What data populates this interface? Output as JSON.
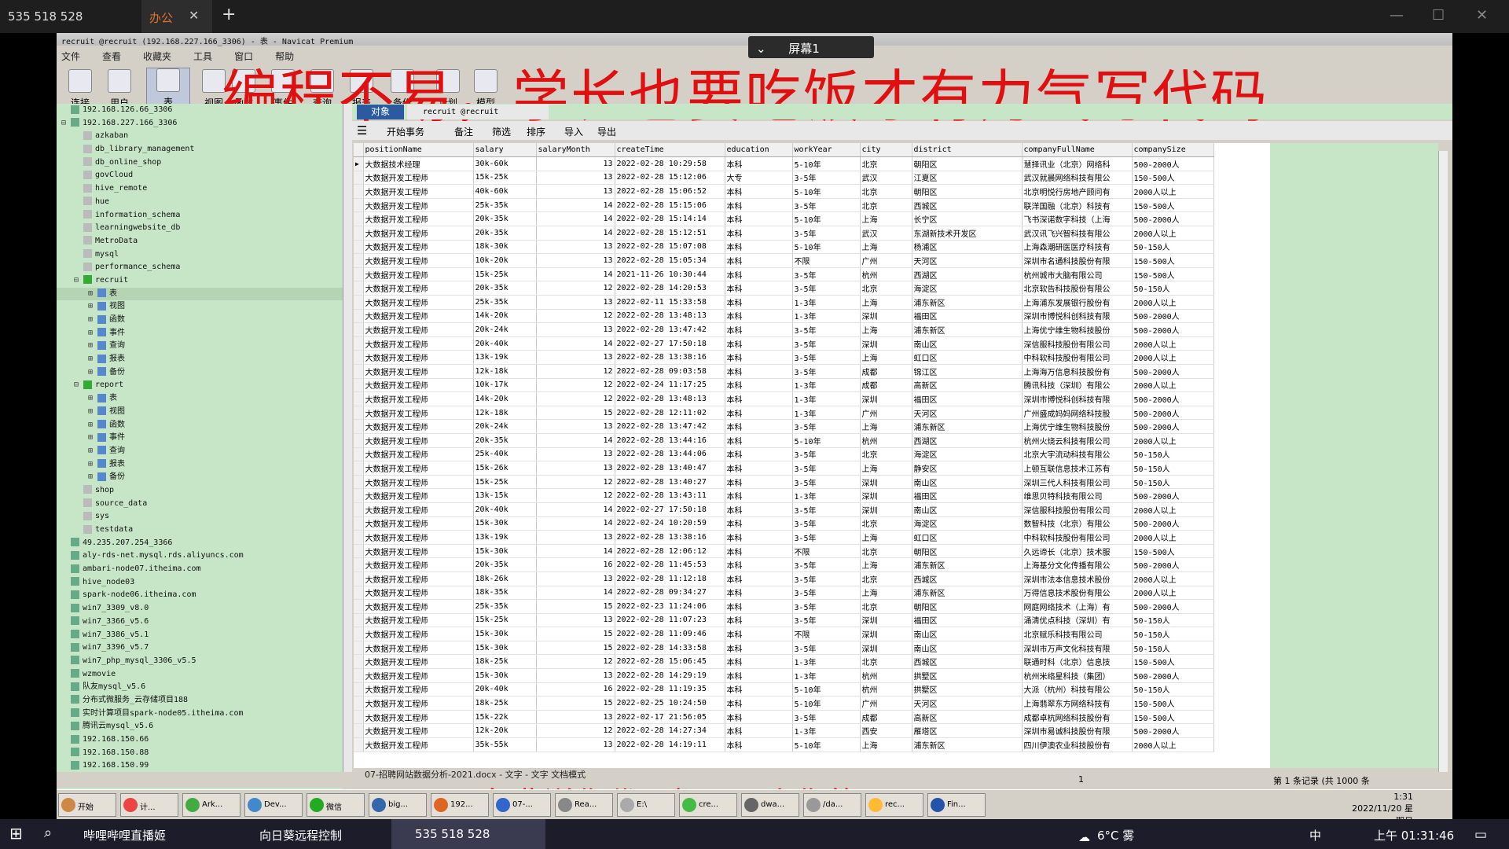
{
  "remote": {
    "signal_label": "535 518 528",
    "tab_label": "办公",
    "close": "✕",
    "new": "+",
    "min": "—",
    "max": "☐",
    "close_win": "✕"
  },
  "window": {
    "title": "recruit @recruit (192.168.227.166_3306) - 表 - Navicat Premium",
    "screen_label": "屏幕1"
  },
  "menu": [
    "文件",
    "查看",
    "收藏夹",
    "工具",
    "窗口",
    "帮助"
  ],
  "toolbar": [
    "连接",
    "用户",
    "表",
    "视图",
    "函数",
    "事件",
    "查询",
    "报表",
    "备份",
    "计划",
    "模型"
  ],
  "overlay": {
    "banner": "编程不易，学长也要吃饭才有力气写代码",
    "bottom": "免费送你代码都是马扁你的"
  },
  "tree": [
    {
      "t": "192.168.126.66_3306",
      "l": 1,
      "k": "conn"
    },
    {
      "t": "192.168.227.166_3306",
      "l": 1,
      "k": "conn",
      "open": true
    },
    {
      "t": "azkaban",
      "l": 2,
      "k": "db"
    },
    {
      "t": "db_library_management",
      "l": 2,
      "k": "db"
    },
    {
      "t": "db_online_shop",
      "l": 2,
      "k": "db"
    },
    {
      "t": "govCloud",
      "l": 2,
      "k": "db"
    },
    {
      "t": "hive_remote",
      "l": 2,
      "k": "db"
    },
    {
      "t": "hue",
      "l": 2,
      "k": "db"
    },
    {
      "t": "information_schema",
      "l": 2,
      "k": "db"
    },
    {
      "t": "learningwebsite_db",
      "l": 2,
      "k": "db"
    },
    {
      "t": "MetroData",
      "l": 2,
      "k": "db"
    },
    {
      "t": "mysql",
      "l": 2,
      "k": "db"
    },
    {
      "t": "performance_schema",
      "l": 2,
      "k": "db"
    },
    {
      "t": "recruit",
      "l": 2,
      "k": "dbopen",
      "open": true
    },
    {
      "t": "表",
      "l": 3,
      "k": "obj",
      "sel": true
    },
    {
      "t": "视图",
      "l": 3,
      "k": "obj"
    },
    {
      "t": "函数",
      "l": 3,
      "k": "obj"
    },
    {
      "t": "事件",
      "l": 3,
      "k": "obj"
    },
    {
      "t": "查询",
      "l": 3,
      "k": "obj"
    },
    {
      "t": "报表",
      "l": 3,
      "k": "obj"
    },
    {
      "t": "备份",
      "l": 3,
      "k": "obj"
    },
    {
      "t": "report",
      "l": 2,
      "k": "dbopen",
      "open": true
    },
    {
      "t": "表",
      "l": 3,
      "k": "obj"
    },
    {
      "t": "视图",
      "l": 3,
      "k": "obj"
    },
    {
      "t": "函数",
      "l": 3,
      "k": "obj"
    },
    {
      "t": "事件",
      "l": 3,
      "k": "obj"
    },
    {
      "t": "查询",
      "l": 3,
      "k": "obj"
    },
    {
      "t": "报表",
      "l": 3,
      "k": "obj"
    },
    {
      "t": "备份",
      "l": 3,
      "k": "obj"
    },
    {
      "t": "shop",
      "l": 2,
      "k": "db"
    },
    {
      "t": "source_data",
      "l": 2,
      "k": "db"
    },
    {
      "t": "sys",
      "l": 2,
      "k": "db"
    },
    {
      "t": "testdata",
      "l": 2,
      "k": "db"
    },
    {
      "t": "49.235.207.254_3366",
      "l": 1,
      "k": "conn"
    },
    {
      "t": "aly-rds-net.mysql.rds.aliyuncs.com",
      "l": 1,
      "k": "conn"
    },
    {
      "t": "ambari-node07.itheima.com",
      "l": 1,
      "k": "conn"
    },
    {
      "t": "hive_node03",
      "l": 1,
      "k": "conn"
    },
    {
      "t": "spark-node06.itheima.com",
      "l": 1,
      "k": "conn"
    },
    {
      "t": "win7_3309_v8.0",
      "l": 1,
      "k": "conn"
    },
    {
      "t": "win7_3366_v5.6",
      "l": 1,
      "k": "conn"
    },
    {
      "t": "win7_3386_v5.1",
      "l": 1,
      "k": "conn"
    },
    {
      "t": "win7_3396_v5.7",
      "l": 1,
      "k": "conn"
    },
    {
      "t": "win7_php_mysql_3306_v5.5",
      "l": 1,
      "k": "conn"
    },
    {
      "t": "wzmovie",
      "l": 1,
      "k": "conn"
    },
    {
      "t": "队友mysql_v5.6",
      "l": 1,
      "k": "conn"
    },
    {
      "t": "分布式微服务_云存储项目188",
      "l": 1,
      "k": "conn"
    },
    {
      "t": "实时计算项目spark-node05.itheima.com",
      "l": 1,
      "k": "conn"
    },
    {
      "t": "腾讯云mysql_v5.6",
      "l": 1,
      "k": "conn"
    },
    {
      "t": "192.168.150.66",
      "l": 1,
      "k": "conn"
    },
    {
      "t": "192.168.150.88",
      "l": 1,
      "k": "conn"
    },
    {
      "t": "192.168.150.99",
      "l": 1,
      "k": "conn"
    }
  ],
  "tabs": {
    "objects": "对象",
    "table_tab": "recruit @recruit (192.168..."
  },
  "obj_toolbar": [
    "开始事务",
    "备注",
    "筛选",
    "排序",
    "导入",
    "导出"
  ],
  "table": {
    "columns": [
      "positionName",
      "salary",
      "salaryMonth",
      "createTime",
      "education",
      "workYear",
      "city",
      "district",
      "companyFullName",
      "companySize"
    ],
    "rows": [
      [
        "大数据技术经理",
        "30k-60k",
        "13",
        "2022-02-28 10:29:58",
        "本科",
        "5-10年",
        "北京",
        "朝阳区",
        "慧择讯业（北京）网络科",
        "500-2000人"
      ],
      [
        "大数据开发工程师",
        "15k-25k",
        "13",
        "2022-02-28 15:12:06",
        "大专",
        "3-5年",
        "武汉",
        "江夏区",
        "武汉就晨网络科技有限公",
        "150-500人"
      ],
      [
        "大数据开发工程师",
        "40k-60k",
        "13",
        "2022-02-28 15:06:52",
        "本科",
        "5-10年",
        "北京",
        "朝阳区",
        "北京明悦行房地产顾问有",
        "2000人以上"
      ],
      [
        "大数据开发工程师",
        "25k-35k",
        "14",
        "2022-02-28 15:15:06",
        "本科",
        "3-5年",
        "北京",
        "西城区",
        "联洋国融（北京）科技有",
        "150-500人"
      ],
      [
        "大数据开发工程师",
        "20k-35k",
        "14",
        "2022-02-28 15:14:14",
        "本科",
        "5-10年",
        "上海",
        "长宁区",
        "飞书深诺数字科技（上海",
        "500-2000人"
      ],
      [
        "大数据开发工程师",
        "20k-35k",
        "14",
        "2022-02-28 15:12:51",
        "本科",
        "3-5年",
        "武汉",
        "东湖新技术开发区",
        "武汉讯飞兴智科技有限公",
        "2000人以上"
      ],
      [
        "大数据开发工程师",
        "18k-30k",
        "13",
        "2022-02-28 15:07:08",
        "本科",
        "5-10年",
        "上海",
        "杨浦区",
        "上海森潮研医医疗科技有",
        "50-150人"
      ],
      [
        "大数据开发工程师",
        "10k-20k",
        "13",
        "2022-02-28 15:05:34",
        "本科",
        "不限",
        "广州",
        "天河区",
        "深圳市名通科技股份有限",
        "150-500人"
      ],
      [
        "大数据开发工程师",
        "15k-25k",
        "14",
        "2021-11-26 10:30:44",
        "本科",
        "3-5年",
        "杭州",
        "西湖区",
        "杭州城市大脑有限公司",
        "150-500人"
      ],
      [
        "大数据开发工程师",
        "20k-35k",
        "12",
        "2022-02-28 14:20:53",
        "本科",
        "3-5年",
        "北京",
        "海淀区",
        "北京软告科技股份有限公",
        "50-150人"
      ],
      [
        "大数据开发工程师",
        "25k-35k",
        "13",
        "2022-02-11 15:33:58",
        "本科",
        "1-3年",
        "上海",
        "浦东新区",
        "上海浦东发展银行股份有",
        "2000人以上"
      ],
      [
        "大数据开发工程师",
        "14k-20k",
        "12",
        "2022-02-28 13:48:13",
        "本科",
        "1-3年",
        "深圳",
        "福田区",
        "深圳市博悦科创科技有限",
        "500-2000人"
      ],
      [
        "大数据开发工程师",
        "20k-24k",
        "13",
        "2022-02-28 13:47:42",
        "本科",
        "3-5年",
        "上海",
        "浦东新区",
        "上海优宁维生物科技股份",
        "500-2000人"
      ],
      [
        "大数据开发工程师",
        "20k-40k",
        "14",
        "2022-02-27 17:50:18",
        "本科",
        "3-5年",
        "深圳",
        "南山区",
        "深信服科技股份有限公司",
        "2000人以上"
      ],
      [
        "大数据开发工程师",
        "13k-19k",
        "13",
        "2022-02-28 13:38:16",
        "本科",
        "3-5年",
        "上海",
        "虹口区",
        "中科软科技股份有限公司",
        "2000人以上"
      ],
      [
        "大数据开发工程师",
        "12k-18k",
        "12",
        "2022-02-28 09:03:58",
        "本科",
        "3-5年",
        "成都",
        "锦江区",
        "上海海万信息科技股份有",
        "500-2000人"
      ],
      [
        "大数据开发工程师",
        "10k-17k",
        "12",
        "2022-02-24 11:17:25",
        "本科",
        "1-3年",
        "成都",
        "高新区",
        "腾讯科技（深圳）有限公",
        "2000人以上"
      ],
      [
        "大数据开发工程师",
        "14k-20k",
        "12",
        "2022-02-28 13:48:13",
        "本科",
        "1-3年",
        "深圳",
        "福田区",
        "深圳市博悦科创科技有限",
        "500-2000人"
      ],
      [
        "大数据开发工程师",
        "12k-18k",
        "15",
        "2022-02-28 12:11:02",
        "本科",
        "1-3年",
        "广州",
        "天河区",
        "广州盛成妈妈网络科技股",
        "500-2000人"
      ],
      [
        "大数据开发工程师",
        "20k-24k",
        "13",
        "2022-02-28 13:47:42",
        "本科",
        "3-5年",
        "上海",
        "浦东新区",
        "上海优宁维生物科技股份",
        "500-2000人"
      ],
      [
        "大数据开发工程师",
        "20k-35k",
        "14",
        "2022-02-28 13:44:16",
        "本科",
        "5-10年",
        "杭州",
        "西湖区",
        "杭州火烧云科技有限公司",
        "2000人以上"
      ],
      [
        "大数据开发工程师",
        "25k-40k",
        "13",
        "2022-02-28 13:44:06",
        "本科",
        "3-5年",
        "北京",
        "海淀区",
        "北京大宇流动科技有限公",
        "50-150人"
      ],
      [
        "大数据开发工程师",
        "15k-26k",
        "13",
        "2022-02-28 13:40:47",
        "本科",
        "3-5年",
        "上海",
        "静安区",
        "上顿互联信息技术江苏有",
        "50-150人"
      ],
      [
        "大数据开发工程师",
        "15k-25k",
        "12",
        "2022-02-28 13:40:27",
        "本科",
        "3-5年",
        "深圳",
        "南山区",
        "深圳三代人科技有限公司",
        "50-150人"
      ],
      [
        "大数据开发工程师",
        "13k-15k",
        "12",
        "2022-02-28 13:43:11",
        "本科",
        "1-3年",
        "深圳",
        "福田区",
        "维思贝特科技有限公司",
        "500-2000人"
      ],
      [
        "大数据开发工程师",
        "20k-40k",
        "14",
        "2022-02-27 17:50:18",
        "本科",
        "3-5年",
        "深圳",
        "南山区",
        "深信服科技股份有限公司",
        "2000人以上"
      ],
      [
        "大数据开发工程师",
        "15k-30k",
        "14",
        "2022-02-24 10:20:59",
        "本科",
        "3-5年",
        "北京",
        "海淀区",
        "数智科技（北京）有限公",
        "500-2000人"
      ],
      [
        "大数据开发工程师",
        "13k-19k",
        "13",
        "2022-02-28 13:38:16",
        "本科",
        "3-5年",
        "上海",
        "虹口区",
        "中科软科技股份有限公司",
        "2000人以上"
      ],
      [
        "大数据开发工程师",
        "15k-30k",
        "14",
        "2022-02-28 12:06:12",
        "本科",
        "不限",
        "北京",
        "朝阳区",
        "久远谛长（北京）技术服",
        "150-500人"
      ],
      [
        "大数据开发工程师",
        "20k-35k",
        "16",
        "2022-02-28 11:45:53",
        "本科",
        "3-5年",
        "上海",
        "浦东新区",
        "上海基分文化传播有限公",
        "500-2000人"
      ],
      [
        "大数据开发工程师",
        "18k-26k",
        "13",
        "2022-02-28 11:12:18",
        "本科",
        "3-5年",
        "北京",
        "西城区",
        "深圳市法本信息技术股份",
        "2000人以上"
      ],
      [
        "大数据开发工程师",
        "18k-35k",
        "14",
        "2022-02-28 09:34:27",
        "本科",
        "3-5年",
        "上海",
        "浦东新区",
        "万得信息技术股份有限公",
        "2000人以上"
      ],
      [
        "大数据开发工程师",
        "25k-35k",
        "15",
        "2022-02-23 11:24:06",
        "本科",
        "3-5年",
        "北京",
        "朝阳区",
        "网庭网络技术（上海）有",
        "500-2000人"
      ],
      [
        "大数据开发工程师",
        "15k-25k",
        "13",
        "2022-02-28 11:07:23",
        "本科",
        "3-5年",
        "深圳",
        "福田区",
        "涌淸优点科技（深圳）有",
        "50-150人"
      ],
      [
        "大数据开发工程师",
        "15k-30k",
        "15",
        "2022-02-28 11:09:46",
        "本科",
        "不限",
        "深圳",
        "南山区",
        "北京赋乐科技有限公司",
        "50-150人"
      ],
      [
        "大数据开发工程师",
        "15k-30k",
        "15",
        "2022-02-28 14:33:58",
        "本科",
        "3-5年",
        "深圳",
        "南山区",
        "深圳市万声文化科技有限",
        "50-150人"
      ],
      [
        "大数据开发工程师",
        "18k-25k",
        "12",
        "2022-02-28 15:06:45",
        "本科",
        "1-3年",
        "北京",
        "西城区",
        "联通时科（北京）信息技",
        "150-500人"
      ],
      [
        "大数据开发工程师",
        "15k-30k",
        "13",
        "2022-02-28 14:29:19",
        "本科",
        "1-3年",
        "杭州",
        "拱墅区",
        "杭州米络星科技（集团）",
        "500-2000人"
      ],
      [
        "大数据开发工程师",
        "20k-40k",
        "16",
        "2022-02-28 11:19:35",
        "本科",
        "5-10年",
        "杭州",
        "拱墅区",
        "大派（杭州）科技有限公",
        "50-150人"
      ],
      [
        "大数据开发工程师",
        "18k-25k",
        "15",
        "2022-02-25 10:24:50",
        "本科",
        "5-10年",
        "广州",
        "天河区",
        "上海翡翠东方网络科技有",
        "150-500人"
      ],
      [
        "大数据开发工程师",
        "15k-22k",
        "13",
        "2022-02-17 21:56:05",
        "本科",
        "3-5年",
        "成都",
        "高新区",
        "成都卓杭网络科技股份有",
        "150-500人"
      ],
      [
        "大数据开发工程师",
        "12k-20k",
        "12",
        "2022-02-28 14:27:34",
        "本科",
        "1-3年",
        "西安",
        "雁塔区",
        "深圳市易诚科技股份有限",
        "500-2000人"
      ],
      [
        "大数据开发工程师",
        "35k-55k",
        "13",
        "2022-02-28 14:19:11",
        "本科",
        "5-10年",
        "上海",
        "浦东新区",
        "四川伊澳农业科技股份有",
        "2000人以上"
      ]
    ]
  },
  "status": {
    "record": "第 1 条记录 (共 1000 条",
    "page": "1"
  },
  "doc_tab": "07-招聘网站数据分析-2021.docx - 文字 - 文字 文档模式",
  "tasks": [
    "开始",
    "计...",
    "Ark...",
    "Dev...",
    "微信",
    "big...",
    "192...",
    "07-...",
    "Rea...",
    "E:\\",
    "cre...",
    "dwa...",
    "/da...",
    "rec...",
    "Fin..."
  ],
  "clock": {
    "time": "1:31",
    "date": "2022/11/20 星期日"
  },
  "win": {
    "items": [
      "哔哩哔哩直播姬",
      "向日葵远程控制",
      "535 518 528"
    ],
    "weather": "6°C 雾",
    "ime": "中",
    "time": "上午 01:31:46"
  },
  "colors": {
    "banner": "#e01010",
    "tree_bg": "#c7e6c7",
    "tab_active": "#2c5aa0"
  }
}
